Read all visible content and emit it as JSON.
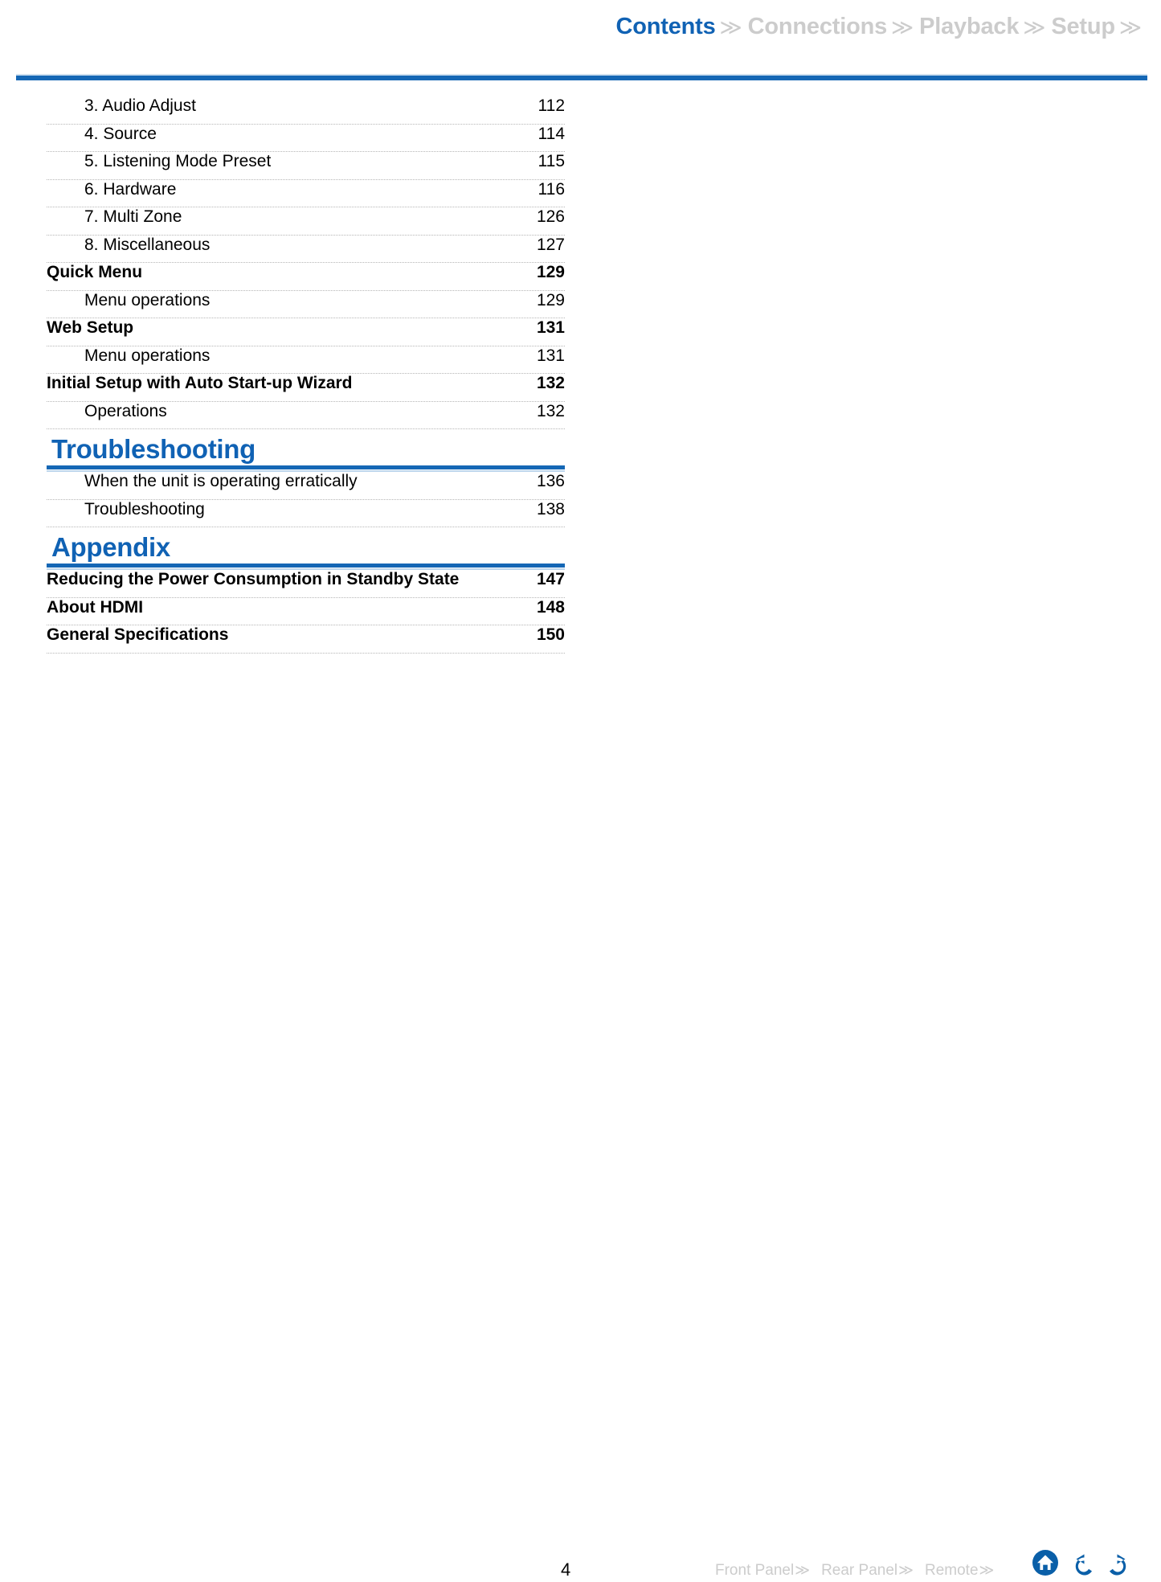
{
  "colors": {
    "accent_blue": "#1062b4",
    "rule_blue": "#1567b5",
    "rule_light_blue": "#bcd5ec",
    "inactive_gray": "#cccccc",
    "dotted_gray": "#b6b6b6"
  },
  "top_nav": {
    "items": [
      {
        "label": "Contents",
        "state": "active",
        "chevron": "≫"
      },
      {
        "label": "Connections",
        "state": "inactive",
        "chevron": "≫"
      },
      {
        "label": "Playback",
        "state": "inactive",
        "chevron": "≫"
      },
      {
        "label": "Setup",
        "state": "inactive",
        "chevron": "≫"
      }
    ]
  },
  "toc": {
    "blocks": [
      {
        "kind": "rows",
        "rows": [
          {
            "level": 2,
            "title": "3. Audio Adjust",
            "page": "112"
          },
          {
            "level": 2,
            "title": "4. Source",
            "page": "114"
          },
          {
            "level": 2,
            "title": "5. Listening Mode Preset",
            "page": "115"
          },
          {
            "level": 2,
            "title": "6. Hardware",
            "page": "116"
          },
          {
            "level": 2,
            "title": "7. Multi Zone",
            "page": "126"
          },
          {
            "level": 2,
            "title": "8. Miscellaneous",
            "page": "127"
          },
          {
            "level": 1,
            "title": "Quick Menu",
            "page": "129"
          },
          {
            "level": 2,
            "title": "Menu operations",
            "page": "129"
          },
          {
            "level": 1,
            "title": "Web Setup",
            "page": "131"
          },
          {
            "level": 2,
            "title": "Menu operations",
            "page": "131"
          },
          {
            "level": 1,
            "title": "Initial Setup with Auto Start-up Wizard",
            "page": "132"
          },
          {
            "level": 2,
            "title": "Operations",
            "page": "132"
          }
        ]
      },
      {
        "kind": "section",
        "title": "Troubleshooting",
        "rows": [
          {
            "level": 2,
            "title": "When the unit is operating erratically",
            "page": "136"
          },
          {
            "level": 2,
            "title": "Troubleshooting",
            "page": "138"
          }
        ]
      },
      {
        "kind": "section",
        "title": "Appendix",
        "rows": [
          {
            "level": 1,
            "title": "Reducing the Power Consumption in Standby State",
            "page": "147"
          },
          {
            "level": 1,
            "title": "About HDMI",
            "page": "148"
          },
          {
            "level": 1,
            "title": "General Specifications",
            "page": "150"
          }
        ]
      }
    ]
  },
  "footer": {
    "page_number": "4",
    "links": [
      {
        "label": "Front Panel",
        "chevron": "≫"
      },
      {
        "label": "Rear Panel",
        "chevron": "≫"
      },
      {
        "label": "Remote",
        "chevron": "≫"
      }
    ],
    "icons": [
      {
        "name": "home-icon",
        "title": "Home"
      },
      {
        "name": "back-arrow-icon",
        "title": "Back"
      },
      {
        "name": "forward-arrow-icon",
        "title": "Forward"
      }
    ]
  }
}
